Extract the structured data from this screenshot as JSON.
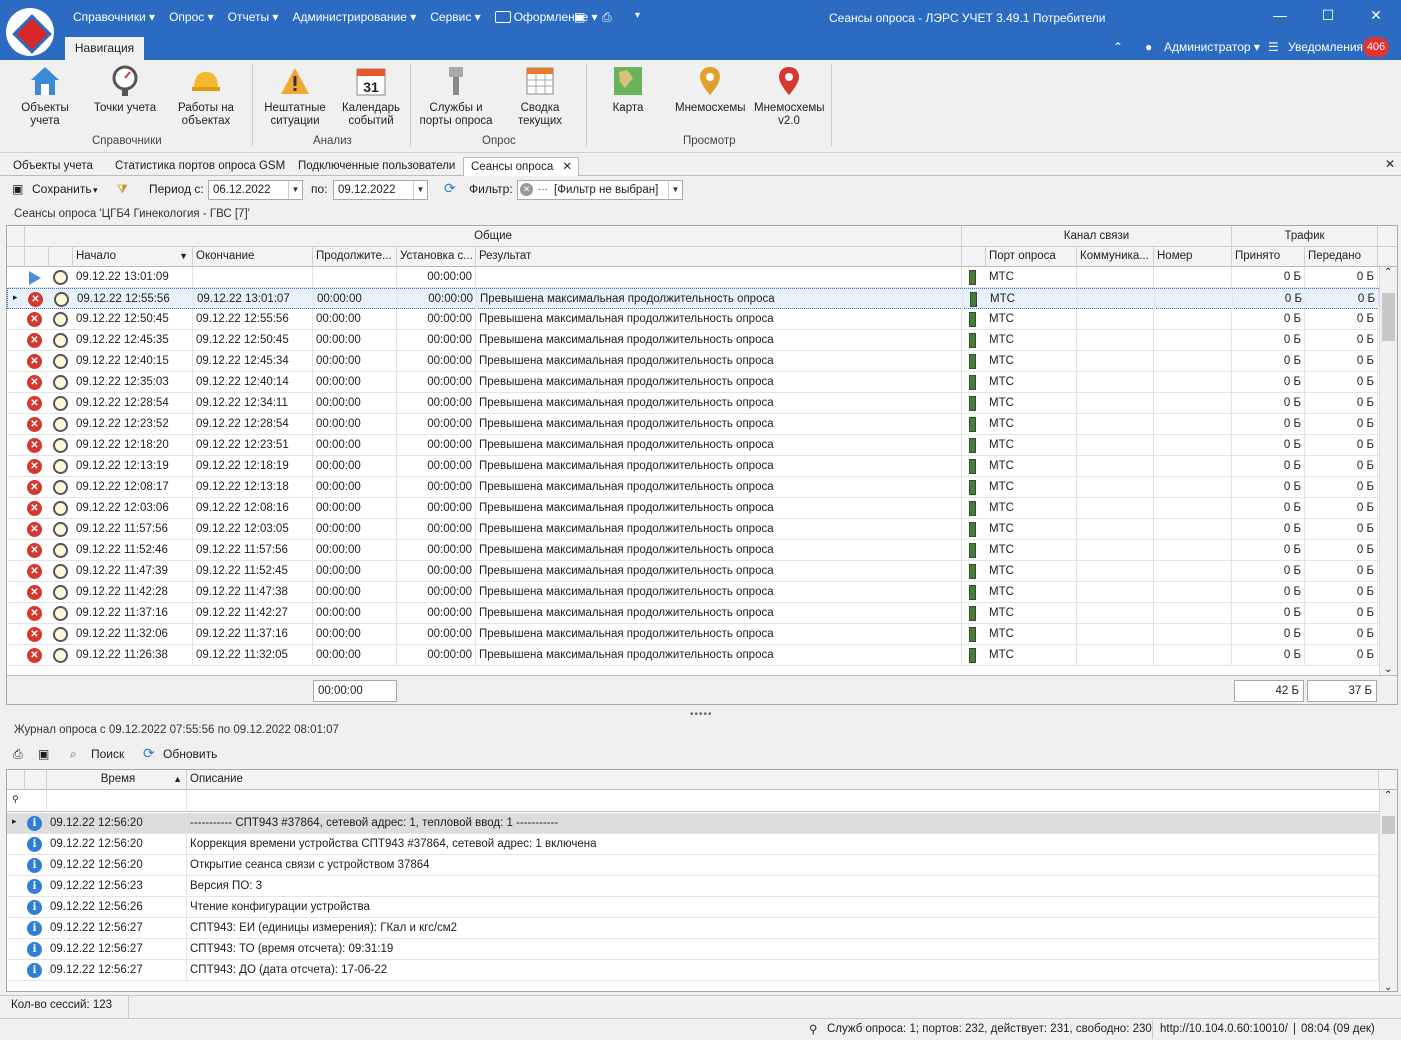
{
  "titlebar": {
    "app_title": "Сеансы опроса - ЛЭРС УЧЕТ 3.49.1 Потребители",
    "menu": [
      "Справочники ▾",
      "Опрос ▾",
      "Отчеты ▾",
      "Администрирование ▾",
      "Сервис ▾",
      "Оформление ▾"
    ],
    "nav_tab": "Навигация",
    "user": "Администратор ▾",
    "notifications_label": "Уведомления",
    "notifications_count": "406"
  },
  "ribbon": {
    "groups": [
      {
        "label": "Справочники",
        "buttons": [
          "Объекты\nучета",
          "Точки учета",
          "Работы на\nобъектах"
        ]
      },
      {
        "label": "Анализ",
        "buttons": [
          "Нештатные\nситуации",
          "Календарь\nсобытий"
        ]
      },
      {
        "label": "Опрос",
        "buttons": [
          "Службы и\nпорты опроса",
          "Сводка\nтекущих"
        ]
      },
      {
        "label": "Просмотр",
        "buttons": [
          "Карта",
          "Мнемосхемы",
          "Мнемосхемы\nv2.0"
        ]
      }
    ],
    "calendar_day": "31"
  },
  "doc_tabs": [
    "Объекты учета",
    "Статистика портов опроса GSM",
    "Подключенные пользователи",
    "Сеансы опроса"
  ],
  "toolbar": {
    "save": "Сохранить",
    "period_from_label": "Период с:",
    "period_from": "06.12.2022",
    "period_to_label": "по:",
    "period_to": "09.12.2022",
    "filter_label": "Фильтр:",
    "filter_value": "[Фильтр не выбран]"
  },
  "sessions": {
    "title": "Сеансы опроса 'ЦГБ4 Гинекология - ГВС [7]'",
    "bands": [
      "Общие",
      "Канал связи",
      "Трафик"
    ],
    "columns": [
      "Начало",
      "Окончание",
      "Продолжите...",
      "Установка с...",
      "Результат",
      "Порт опроса",
      "Коммуника...",
      "Номер",
      "Принято",
      "Передано"
    ],
    "first_row": {
      "start": "09.12.22 13:01:09",
      "setup": "00:00:00",
      "port": "МТС",
      "recv": "0 Б",
      "sent": "0 Б"
    },
    "rows": [
      [
        "09.12.22 12:55:56",
        "09.12.22 13:01:07"
      ],
      [
        "09.12.22 12:50:45",
        "09.12.22 12:55:56"
      ],
      [
        "09.12.22 12:45:35",
        "09.12.22 12:50:45"
      ],
      [
        "09.12.22 12:40:15",
        "09.12.22 12:45:34"
      ],
      [
        "09.12.22 12:35:03",
        "09.12.22 12:40:14"
      ],
      [
        "09.12.22 12:28:54",
        "09.12.22 12:34:11"
      ],
      [
        "09.12.22 12:23:52",
        "09.12.22 12:28:54"
      ],
      [
        "09.12.22 12:18:20",
        "09.12.22 12:23:51"
      ],
      [
        "09.12.22 12:13:19",
        "09.12.22 12:18:19"
      ],
      [
        "09.12.22 12:08:17",
        "09.12.22 12:13:18"
      ],
      [
        "09.12.22 12:03:06",
        "09.12.22 12:08:16"
      ],
      [
        "09.12.22 11:57:56",
        "09.12.22 12:03:05"
      ],
      [
        "09.12.22 11:52:46",
        "09.12.22 11:57:56"
      ],
      [
        "09.12.22 11:47:39",
        "09.12.22 11:52:45"
      ],
      [
        "09.12.22 11:42:28",
        "09.12.22 11:47:38"
      ],
      [
        "09.12.22 11:37:16",
        "09.12.22 11:42:27"
      ],
      [
        "09.12.22 11:32:06",
        "09.12.22 11:37:16"
      ],
      [
        "09.12.22 11:26:38",
        "09.12.22 11:32:05"
      ]
    ],
    "row_common": {
      "duration": "00:00:00",
      "setup": "00:00:00",
      "result": "Превышена максимальная продолжительность опроса",
      "port": "МТС",
      "recv": "0 Б",
      "sent": "0 Б"
    },
    "footer": {
      "duration_total": "00:00:00",
      "recv_total": "42 Б",
      "sent_total": "37 Б"
    }
  },
  "journal": {
    "title": "Журнал опроса с 09.12.2022 07:55:56 по 09.12.2022 08:01:07",
    "search": "Поиск",
    "refresh": "Обновить",
    "columns": [
      "Время",
      "Описание"
    ],
    "rows": [
      [
        "09.12.22 12:56:20",
        "----------- СПТ943 #37864, сетевой адрес: 1, тепловой ввод: 1 -----------"
      ],
      [
        "09.12.22 12:56:20",
        "Коррекция времени устройства СПТ943 #37864, сетевой адрес: 1 включена"
      ],
      [
        "09.12.22 12:56:20",
        "Открытие сеанса связи с устройством 37864"
      ],
      [
        "09.12.22 12:56:23",
        "Версия ПО: 3"
      ],
      [
        "09.12.22 12:56:26",
        "Чтение конфигурации устройства"
      ],
      [
        "09.12.22 12:56:27",
        "СПТ943: ЕИ (единицы измерения): ГКал и кгс/см2"
      ],
      [
        "09.12.22 12:56:27",
        "СПТ943: ТО (время отсчета): 09:31:19"
      ],
      [
        "09.12.22 12:56:27",
        "СПТ943: ДО (дата отсчета): 17-06-22"
      ]
    ]
  },
  "status": {
    "sessions_count": "Кол-во сессий: 123",
    "services": "Служб опроса: 1; портов: 232, действует: 231, свободно: 230",
    "server": "http://10.104.0.60:10010/",
    "time": "08:04 (09 дек)"
  }
}
